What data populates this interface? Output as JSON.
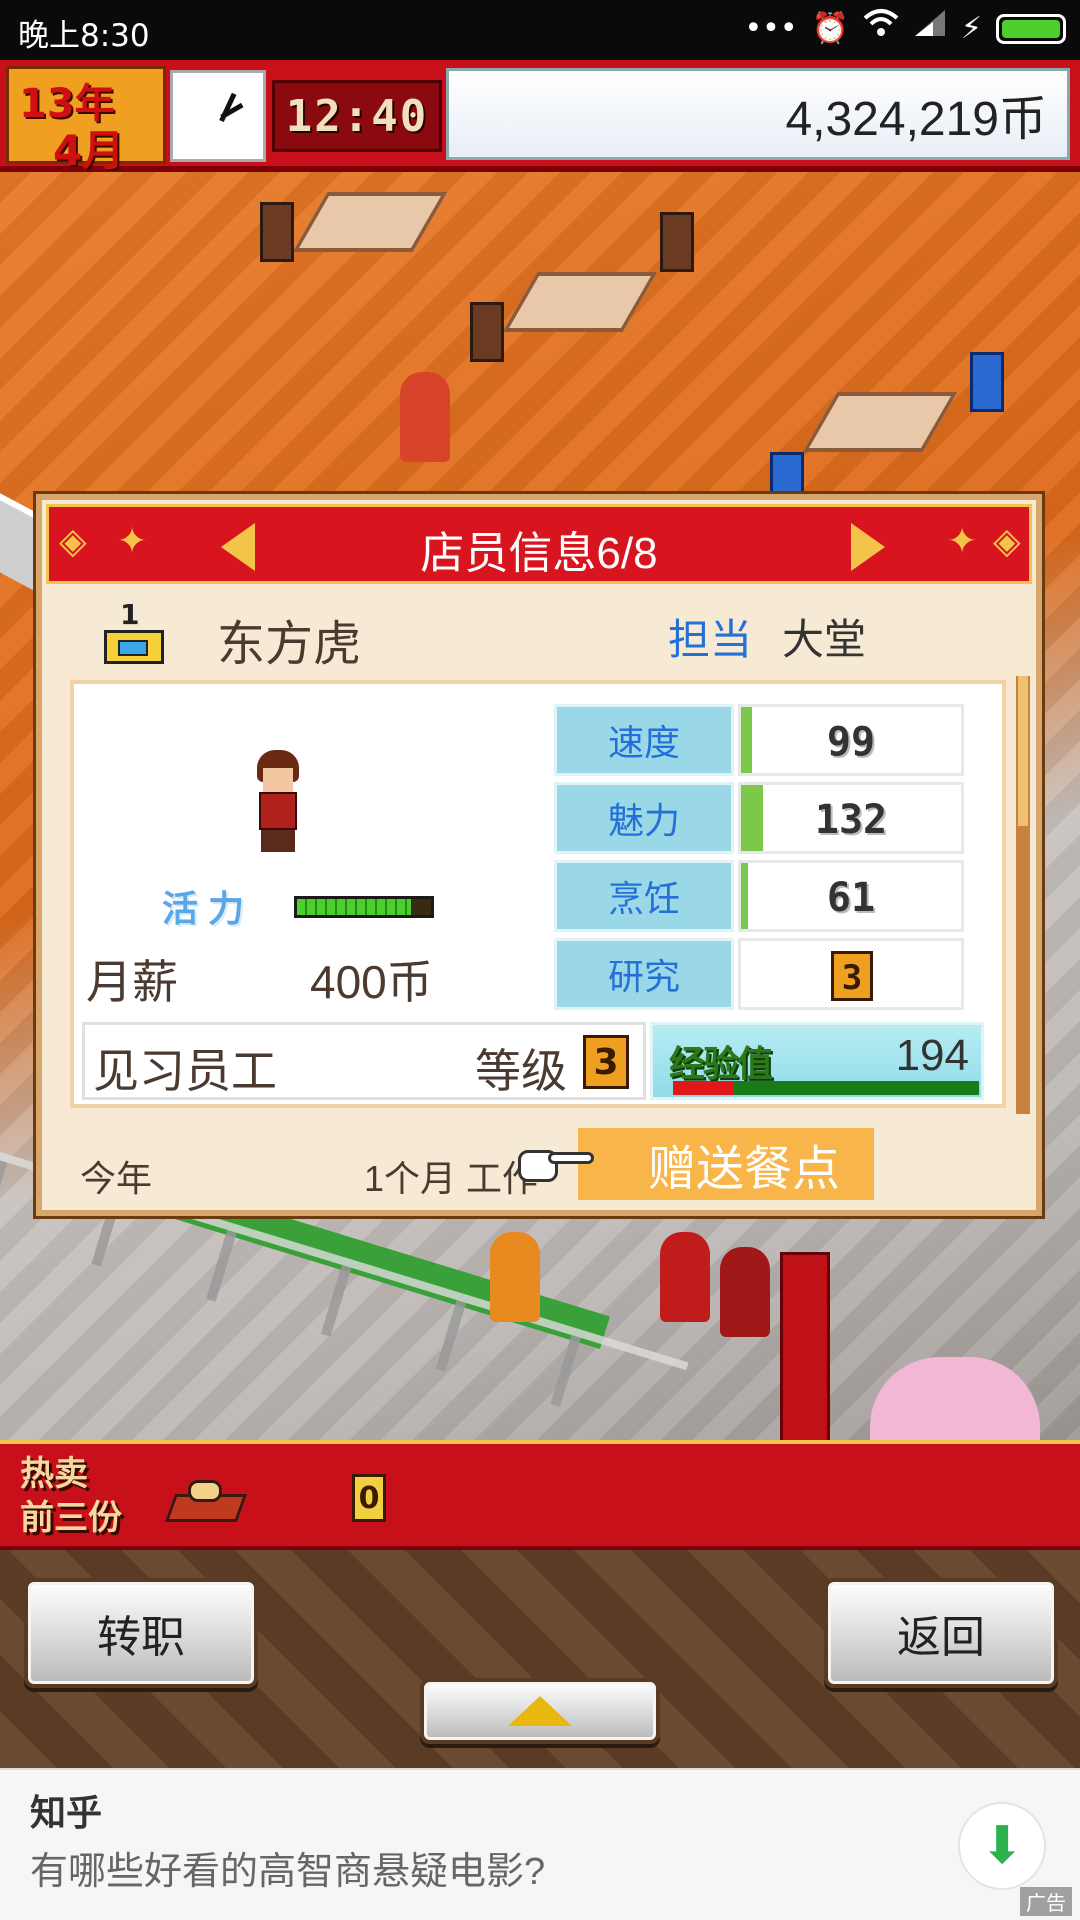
{
  "status_bar": {
    "time": "晚上8:30",
    "icons": [
      "more-dots-icon",
      "alarm-icon",
      "wifi-icon",
      "signal-icon",
      "charging-icon",
      "battery-icon"
    ],
    "battery_color": "#4ccf2c"
  },
  "hud": {
    "year": "13年",
    "month": "4月",
    "time": "12:40",
    "money": "4,324,219币"
  },
  "dialog": {
    "title": "店员信息6/8",
    "rank_icon_number": "1",
    "staff_name": "东方虎",
    "assign_label": "担当",
    "assign_value": "大堂",
    "vitality_label": "活力",
    "vitality_level": 0.85,
    "salary_label": "月薪",
    "salary_value": "400币",
    "stats": [
      {
        "name": "速度",
        "value": "99",
        "bar": 0.05
      },
      {
        "name": "魅力",
        "value": "132",
        "bar": 0.1
      },
      {
        "name": "烹饪",
        "value": "61",
        "bar": 0.03
      },
      {
        "name": "研究",
        "value": "3",
        "bar": 0
      }
    ],
    "rank_name": "见习员工",
    "level_label": "等级",
    "level_value": "3",
    "exp_label": "经验值",
    "exp_value": "194",
    "exp_progress": 0.2,
    "footer_year": "今年",
    "footer_work": "1个月 工作",
    "gift_button": "赠送餐点"
  },
  "bestsellers": {
    "label_line1": "热卖",
    "label_line2": "前三份",
    "count": "0"
  },
  "controls": {
    "transfer_label": "转职",
    "back_label": "返回"
  },
  "ad": {
    "brand": "知乎",
    "text": "有哪些好看的高智商悬疑电影?",
    "tag": "广告"
  },
  "colors": {
    "accent_red": "#c8101a",
    "stat_label_blue": "#2470d6",
    "gift_orange": "#f7b54a",
    "ad_download_green": "#2bb24c"
  }
}
